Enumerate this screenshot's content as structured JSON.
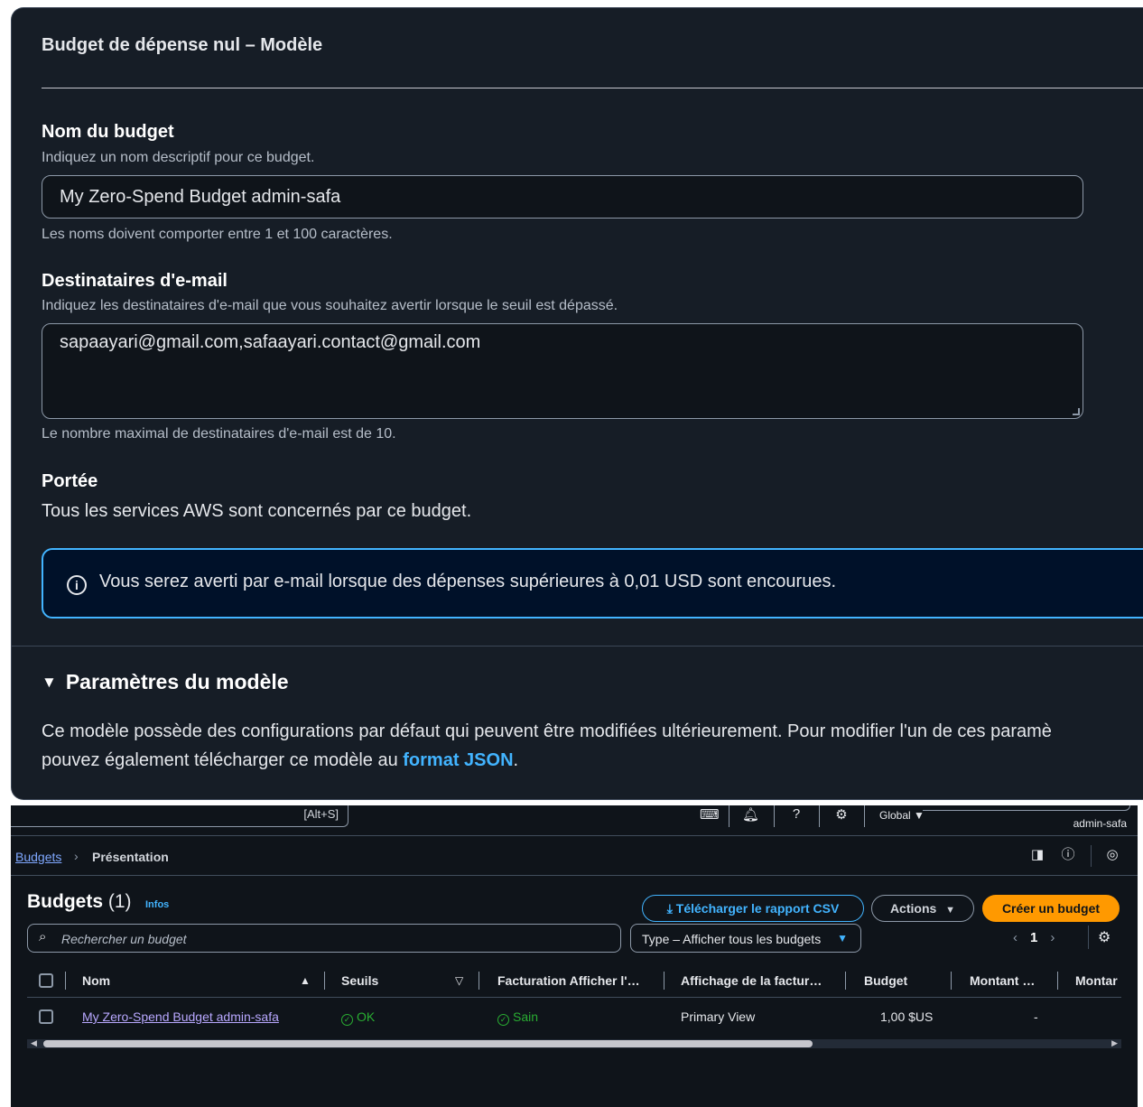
{
  "form": {
    "title": "Budget de dépense nul – Modèle",
    "name_label": "Nom du budget",
    "name_desc": "Indiquez un nom descriptif pour ce budget.",
    "name_value": "My Zero-Spend Budget admin-safa",
    "name_hint": "Les noms doivent comporter entre 1 et 100 caractères.",
    "email_label": "Destinataires d'e-mail",
    "email_desc": "Indiquez les destinataires d'e-mail que vous souhaitez avertir lorsque le seuil est dépassé.",
    "email_value": "sapaayari@gmail.com,safaayari.contact@gmail.com",
    "email_hint": "Le nombre maximal de destinataires d'e-mail est de 10.",
    "scope_label": "Portée",
    "scope_text": "Tous les services AWS sont concernés par ce budget.",
    "alert_text": "Vous serez averti par e-mail lorsque des dépenses supérieures à 0,01 USD sont encourues.",
    "params_title": "Paramètres du modèle",
    "params_line1": "Ce modèle possède des configurations par défaut qui peuvent être modifiées ultérieurement. Pour modifier l'un de ces paramè",
    "params_line2_pre": "pouvez également télécharger ce modèle au ",
    "params_link": "format JSON",
    "params_line2_post": "."
  },
  "topbar": {
    "search_shortcut": "[Alt+S]",
    "region": "Global ▼",
    "account": "admin-safa",
    "icons": [
      "cloudshell-icon",
      "bell-icon",
      "help-icon",
      "gear-icon"
    ]
  },
  "breadcrumb": {
    "root": "Budgets",
    "current": "Présentation"
  },
  "header": {
    "title": "Budgets",
    "count": "(1)",
    "info": "Infos",
    "csv_button": "Télécharger le rapport CSV",
    "actions_button": "Actions",
    "create_button": "Créer un budget"
  },
  "filters": {
    "search_placeholder": "Rechercher un budget",
    "type_filter": "Type – Afficher tous les budgets",
    "page": "1"
  },
  "table": {
    "columns": [
      "Nom",
      "Seuils",
      "Facturation Afficher l'…",
      "Affichage de la factur…",
      "Budget",
      "Montant …",
      "Montar"
    ],
    "rows": [
      {
        "name": "My Zero-Spend Budget admin-safa",
        "thresholds": "OK",
        "billing": "Sain",
        "billing_view": "Primary View",
        "budget": "1,00 $US",
        "amount": "-"
      }
    ]
  },
  "colors": {
    "accent": "#42b4ff",
    "primary_button": "#ff9900",
    "success": "#29ad32",
    "panel_bg": "#161d26"
  }
}
